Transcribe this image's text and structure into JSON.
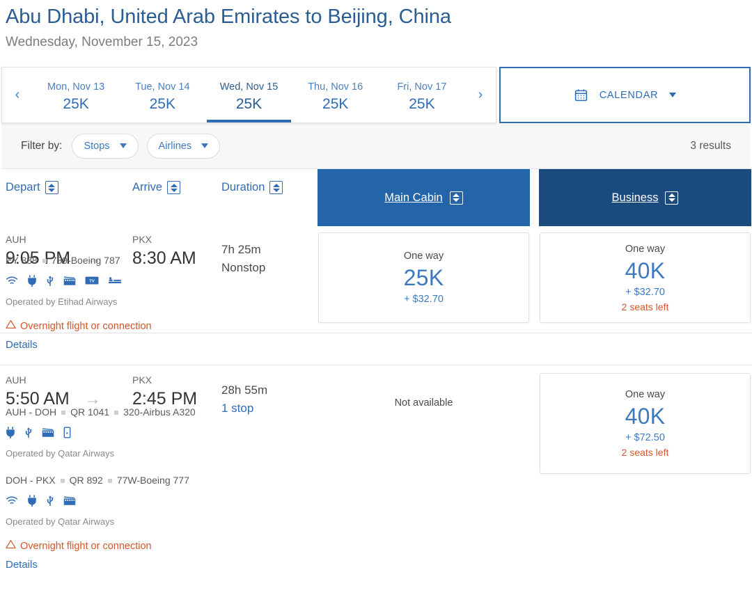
{
  "header": {
    "title": "Abu Dhabi, United Arab Emirates to Beijing, China",
    "subtitle": "Wednesday, November 15, 2023"
  },
  "datebar": {
    "prev_icon": "chevron-left-icon",
    "next_icon": "chevron-right-icon",
    "prev_label": "‹",
    "next_label": "›",
    "dates": [
      {
        "label": "Mon, Nov 13",
        "price": "25K",
        "selected": false
      },
      {
        "label": "Tue, Nov 14",
        "price": "25K",
        "selected": false
      },
      {
        "label": "Wed, Nov 15",
        "price": "25K",
        "selected": true
      },
      {
        "label": "Thu, Nov 16",
        "price": "25K",
        "selected": false
      },
      {
        "label": "Fri, Nov 17",
        "price": "25K",
        "selected": false
      }
    ],
    "calendar": {
      "label": "CALENDAR",
      "icon": "calendar-icon",
      "caret": "chevron-down-icon"
    }
  },
  "filters": {
    "label": "Filter by:",
    "pills": [
      {
        "label": "Stops"
      },
      {
        "label": "Airlines"
      }
    ],
    "results": "3 results"
  },
  "columns": {
    "depart": "Depart",
    "arrive": "Arrive",
    "duration": "Duration",
    "main_cabin": "Main Cabin",
    "business": "Business"
  },
  "colors": {
    "main_cabin_header": "#2464a8",
    "business_header": "#1b4a7e",
    "accent_blue": "#2f6cb5",
    "warn_orange": "#d2562a",
    "title_blue": "#2a5d92"
  },
  "flights": [
    {
      "depart": {
        "code": "AUH",
        "time": "9:05 PM"
      },
      "arrive": {
        "code": "PKX",
        "time": "8:30 AM"
      },
      "arrow": "→",
      "duration": "7h 25m",
      "stops": "Nonstop",
      "stops_is_link": false,
      "segments": [
        {
          "route": "EY 888",
          "equipment": "789-Boeing 787",
          "has_route_prefix": false,
          "amenities": [
            "wifi-icon",
            "power-icon",
            "usb-icon",
            "movie-icon",
            "tv-icon",
            "lieflat-seat-icon"
          ],
          "operated": "Operated by Etihad Airways"
        }
      ],
      "warning": "Overnight flight or connection",
      "details": "Details",
      "main_cabin": {
        "available": true,
        "oneway": "One way",
        "points": "25K",
        "cash": "+ $32.70",
        "seats": ""
      },
      "business": {
        "available": true,
        "oneway": "One way",
        "points": "40K",
        "cash": "+ $32.70",
        "seats": "2 seats left"
      }
    },
    {
      "depart": {
        "code": "AUH",
        "time": "5:50 AM"
      },
      "arrive": {
        "code": "PKX",
        "time": "2:45 PM"
      },
      "arrow": "→",
      "duration": "28h 55m",
      "stops": "1 stop",
      "stops_is_link": true,
      "segments": [
        {
          "route": "AUH - DOH",
          "flight_no": "QR 1041",
          "equipment": "320-Airbus A320",
          "has_route_prefix": true,
          "amenities": [
            "power-icon",
            "usb-icon",
            "movie-icon",
            "device-icon"
          ],
          "operated": "Operated by Qatar Airways"
        },
        {
          "route": "DOH - PKX",
          "flight_no": "QR 892",
          "equipment": "77W-Boeing 777",
          "has_route_prefix": true,
          "amenities": [
            "wifi-icon",
            "power-icon",
            "usb-icon",
            "movie-icon"
          ],
          "operated": "Operated by Qatar Airways"
        }
      ],
      "warning": "Overnight flight or connection",
      "details": "Details",
      "main_cabin": {
        "available": false,
        "not_available": "Not available"
      },
      "business": {
        "available": true,
        "oneway": "One way",
        "points": "40K",
        "cash": "+ $72.50",
        "seats": "2 seats left"
      }
    }
  ]
}
